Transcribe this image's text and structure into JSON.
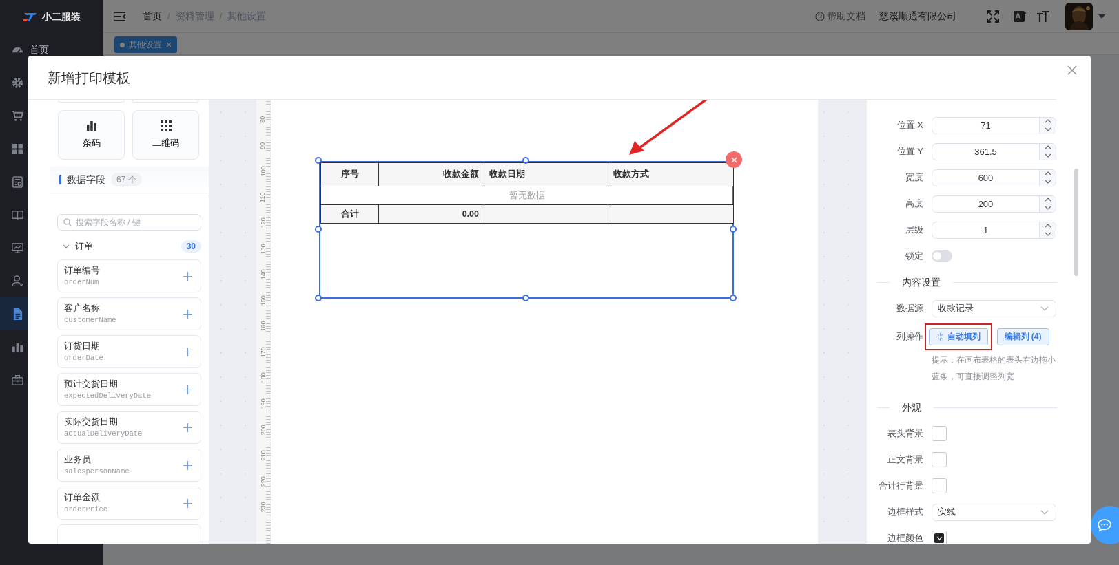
{
  "app": {
    "logo_text": "小二服装"
  },
  "sidebar": {
    "items": [
      {
        "label": "首页",
        "selected": false
      },
      {
        "selected": false
      },
      {
        "selected": false
      },
      {
        "selected": false
      },
      {
        "selected": false
      },
      {
        "selected": false
      },
      {
        "selected": false
      },
      {
        "selected": false
      },
      {
        "selected": true
      },
      {
        "selected": false
      },
      {
        "selected": false
      }
    ]
  },
  "header": {
    "breadcrumb": [
      "首页",
      "资料管理",
      "其他设置"
    ],
    "breadcrumb_separator": "/",
    "help": "帮助文档",
    "company": "慈溪顺通有限公司"
  },
  "tabs": [
    {
      "label": "其他设置",
      "selected": true,
      "closable": true
    }
  ],
  "modal": {
    "title": "新增打印模板"
  },
  "left_panel": {
    "components": [
      {
        "label": "条码"
      },
      {
        "label": "二维码"
      }
    ],
    "fields_header": {
      "title": "数据字段",
      "count": "67 个"
    },
    "search": {
      "placeholder": "搜索字段名称 / 键"
    },
    "groups": [
      {
        "label": "订单",
        "count": "30",
        "expanded": true,
        "fields": [
          {
            "label": "订单编号",
            "key": "orderNum"
          },
          {
            "label": "客户名称",
            "key": "customerName"
          },
          {
            "label": "订货日期",
            "key": "orderDate"
          },
          {
            "label": "预计交货日期",
            "key": "expectedDeliveryDate"
          },
          {
            "label": "实际交货日期",
            "key": "actualDeliveryDate"
          },
          {
            "label": "业务员",
            "key": "salespersonName"
          },
          {
            "label": "订单金额",
            "key": "orderPrice"
          }
        ]
      }
    ]
  },
  "canvas": {
    "ruler_labels": [
      "80",
      "90",
      "100",
      "110",
      "120",
      "130",
      "140",
      "150",
      "160",
      "170",
      "180",
      "190",
      "200",
      "210",
      "220",
      "230"
    ],
    "table": {
      "selected": true,
      "columns": [
        {
          "label": "序号"
        },
        {
          "label": "收款金额"
        },
        {
          "label": "收款日期"
        },
        {
          "label": "收款方式"
        }
      ],
      "empty_text": "暂无数据",
      "total_label": "合计",
      "total_values": [
        "0.00"
      ]
    }
  },
  "properties": {
    "fields": [
      {
        "label": "位置 X",
        "value": "71"
      },
      {
        "label": "位置 Y",
        "value": "361.5"
      },
      {
        "label": "宽度",
        "value": "600"
      },
      {
        "label": "高度",
        "value": "200"
      },
      {
        "label": "层级",
        "value": "1"
      }
    ],
    "lock": {
      "label": "锁定",
      "on": false
    },
    "content_section": "内容设置",
    "data_source": {
      "label": "数据源",
      "value": "收款记录"
    },
    "column_ops": {
      "label": "列操作",
      "buttons": [
        {
          "label": "自动填列",
          "highlighted": true
        },
        {
          "label": "编辑列 (4)",
          "highlighted": false
        }
      ]
    },
    "hint": "提示：在画布表格的表头右边拖小蓝条，可直接调整列宽",
    "appearance_section": "外观",
    "appearance": [
      {
        "kind": "checkbox",
        "label": "表头背景",
        "checked": false
      },
      {
        "kind": "checkbox",
        "label": "正文背景",
        "checked": false
      },
      {
        "kind": "checkbox",
        "label": "合计行背景",
        "checked": false
      },
      {
        "kind": "select",
        "label": "边框样式",
        "value": "实线"
      },
      {
        "kind": "color",
        "label": "边框颜色",
        "color": "#262626"
      }
    ]
  }
}
